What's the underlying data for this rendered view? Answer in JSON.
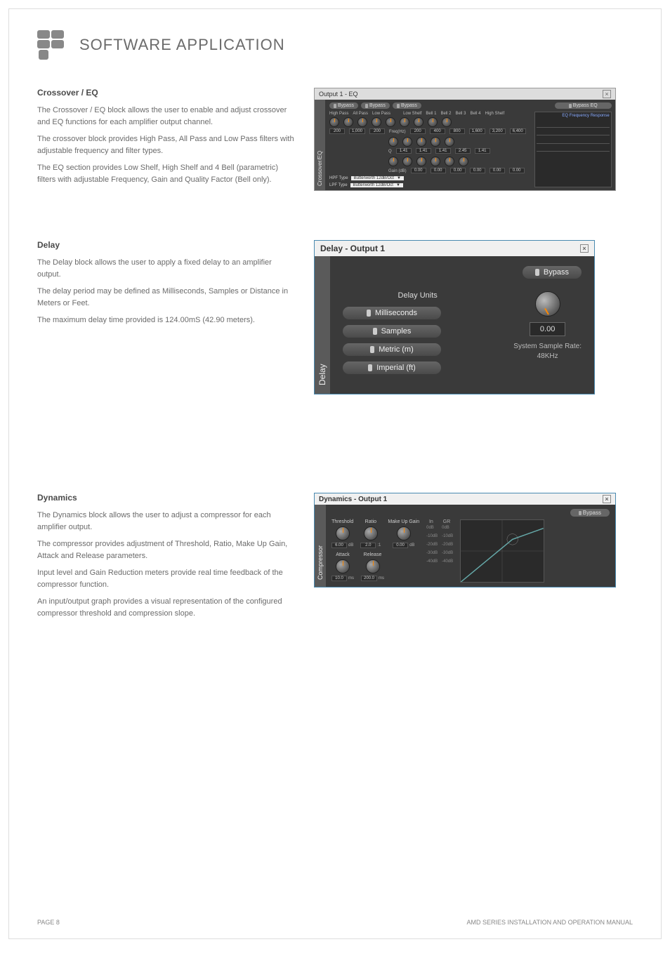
{
  "header": {
    "title": "SOFTWARE APPLICATION"
  },
  "crossover": {
    "heading": "Crossover / EQ",
    "para1": "The Crossover / EQ block allows the user to enable and adjust crossover and EQ functions for each amplifier output channel.",
    "para2": "The crossover block provides High Pass, All Pass and Low Pass filters with adjustable frequency and filter types.",
    "para3": "The EQ section provides Low Shelf, High Shelf and 4 Bell (parametric) filters with adjustable Frequency, Gain and Quality Factor (Bell only).",
    "panel": {
      "title": "Output 1 - EQ",
      "tab": "Crossover/EQ",
      "bypass_labels": [
        "Bypass",
        "Bypass",
        "Bypass"
      ],
      "bypass_eq": "Bypass EQ",
      "freq_response": "EQ Frequency Response",
      "cols": [
        "High Pass",
        "All Pass",
        "Low Pass",
        "Low Shelf",
        "Bell 1",
        "Bell 2",
        "Bell 3",
        "Bell 4",
        "High Shelf"
      ],
      "freq_vals": [
        "200",
        "1,000",
        "200",
        "200",
        "400",
        "800",
        "1,600",
        "3,200",
        "6,400"
      ],
      "freq_label": "Freq(Hz)",
      "q_label": "Q",
      "q_vals": [
        "1.41",
        "1.41",
        "1.41",
        "2.45",
        "1.41"
      ],
      "gain_label": "Gain (dB)",
      "gain_vals": [
        "0.00",
        "0.00",
        "0.00",
        "0.00",
        "0.00",
        "0.00"
      ],
      "hpf_type_label": "HPF Type",
      "lpf_type_label": "LPF Type",
      "filter_option": "Butterworth 12dB/Oct"
    }
  },
  "delay": {
    "heading": "Delay",
    "para1": "The Delay block allows the user to apply a fixed delay to an amplifier output.",
    "para2": "The delay period may be defined as Milliseconds, Samples or Distance in Meters or Feet.",
    "para3": "The maximum delay time provided is 124.00mS  (42.90 meters).",
    "panel": {
      "title": "Delay - Output 1",
      "tab": "Delay",
      "bypass": "Bypass",
      "units_label": "Delay Units",
      "units": [
        "Milliseconds",
        "Samples",
        "Metric (m)",
        "Imperial (ft)"
      ],
      "value": "0.00",
      "samplerate_label": "System Sample Rate:",
      "samplerate_value": "48KHz"
    }
  },
  "dynamics": {
    "heading": "Dynamics",
    "para1": "The Dynamics block allows the user to adjust a compressor for each amplifier output.",
    "para2": "The compressor provides adjustment of Threshold, Ratio, Make Up Gain, Attack and Release parameters.",
    "para3": "Input level and Gain Reduction meters provide real time feedback of the compressor function.",
    "para4": "An input/output graph provides a visual representation of the configured compressor threshold and compression slope.",
    "panel": {
      "title": "Dynamics - Output 1",
      "tab": "Compressor",
      "bypass": "Bypass",
      "knobs": {
        "threshold": {
          "label": "Threshold",
          "value": "6.00",
          "unit": "dB"
        },
        "ratio": {
          "label": "Ratio",
          "value": "2.0",
          "unit": ":1"
        },
        "makeup": {
          "label": "Make Up Gain",
          "value": "0.00",
          "unit": "dB"
        },
        "attack": {
          "label": "Attack",
          "value": "10.0",
          "unit": "ms"
        },
        "release": {
          "label": "Release",
          "value": "200.0",
          "unit": "ms"
        }
      },
      "meter_in": "In",
      "meter_gr": "GR",
      "meter_ticks_in": [
        "0dB",
        "-10dB",
        "-20dB",
        "-30dB",
        "-40dB"
      ],
      "meter_ticks_gr": [
        "0dB",
        "-10dB",
        "-20dB",
        "-30dB",
        "-40dB"
      ]
    }
  },
  "footer": {
    "page": "PAGE 8",
    "manual": "AMD SERIES INSTALLATION AND OPERATION MANUAL"
  }
}
